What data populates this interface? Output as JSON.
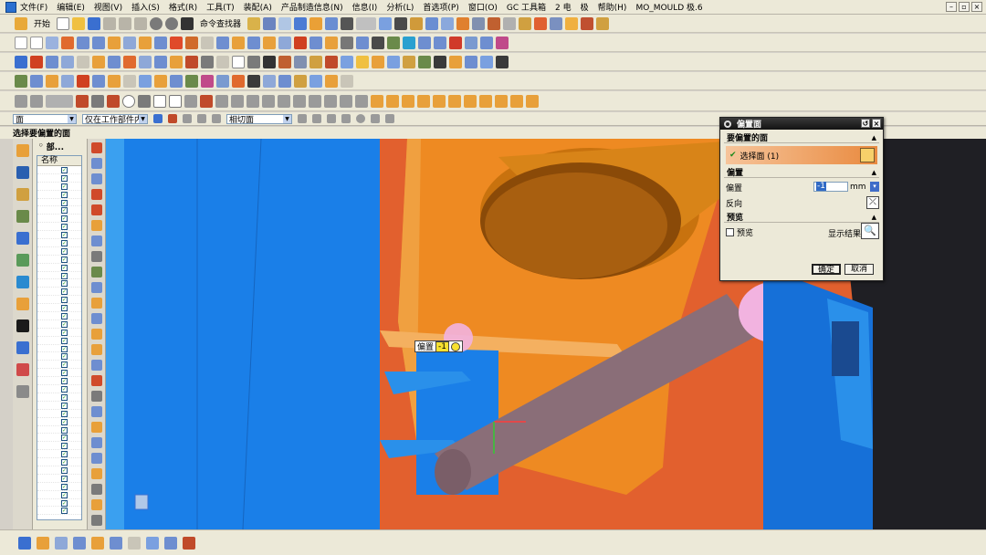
{
  "menu": {
    "items": [
      "文件(F)",
      "编辑(E)",
      "视图(V)",
      "插入(S)",
      "格式(R)",
      "工具(T)",
      "装配(A)",
      "产品制造信息(N)",
      "信息(I)",
      "分析(L)",
      "首选项(P)",
      "窗口(O)",
      "GC 工具箱",
      "2 电",
      "极",
      "帮助(H)",
      "MO_MOULD 极.6"
    ]
  },
  "toolbar": {
    "start_label": "开始",
    "command_finder_label": "命令查找器"
  },
  "selbar": {
    "filter_value": "面",
    "scope_value": "仅在工作部件内",
    "pattern_value": "相切面"
  },
  "cue_line": "选择要偏置的面",
  "navigator": {
    "title": "部...",
    "column_name": "名称",
    "rows": 43
  },
  "dialog": {
    "title": "偏置面",
    "section_faces": "要偏置的面",
    "select_face_label": "选择面 (1)",
    "section_offset": "偏置",
    "offset_label": "偏置",
    "offset_value": "-1",
    "offset_unit": "mm",
    "reverse_label": "反向",
    "section_preview": "预览",
    "preview_label": "预览",
    "show_result_label": "显示结果",
    "ok_label": "确定",
    "cancel_label": "取消"
  },
  "onscreen_tag": {
    "label": "偏置",
    "value": "-1"
  },
  "colors": {
    "blue_part": "#1a7fe8",
    "orange_part": "#ee8a22",
    "red_part": "#e2602e",
    "rod": "#8a6e78",
    "pink_face": "#f2b3e0"
  }
}
